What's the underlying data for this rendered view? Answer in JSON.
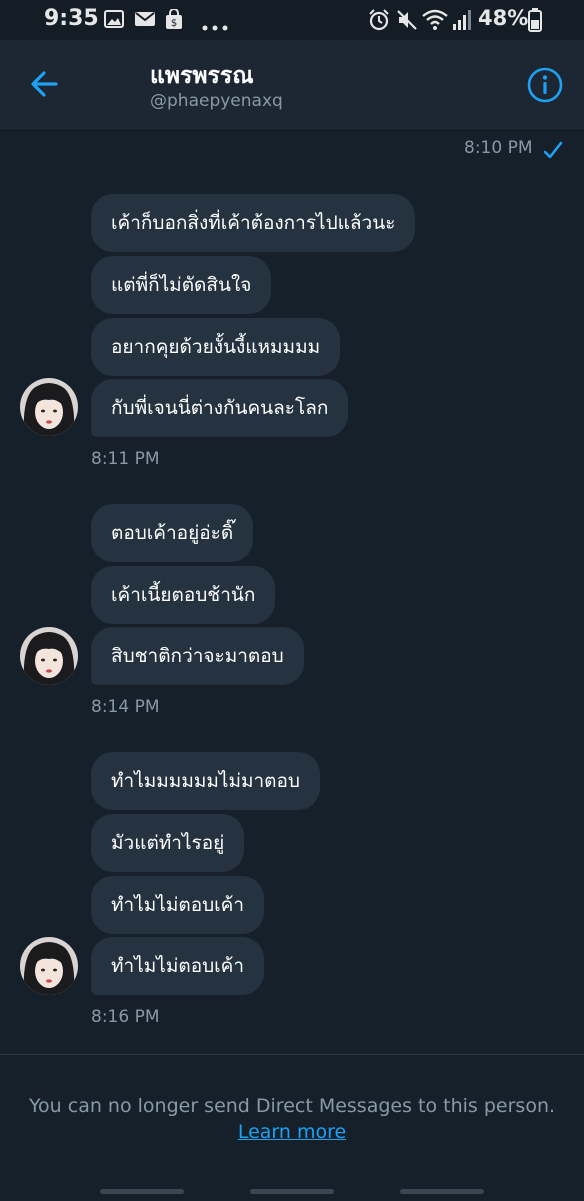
{
  "status_bar": {
    "time": "9:35",
    "battery": "48%",
    "left_icons": [
      "image-icon",
      "mail-icon",
      "shop-icon",
      "more-dots-icon"
    ],
    "right_icons": [
      "alarm-icon",
      "mute-icon",
      "wifi-icon",
      "signal-icon",
      "battery-icon"
    ]
  },
  "header": {
    "name": "แพรพรรณ",
    "handle": "@phaepyenaxq",
    "back_icon": "arrow-left-icon",
    "info_icon": "info-icon",
    "accent_color": "#1da1f2"
  },
  "sent": {
    "time": "8:10 PM",
    "status_icon": "check-icon"
  },
  "groups": [
    {
      "messages": [
        "เค้าก็บอกสิ่งที่เค้าต้องการไปแล้วนะ",
        "แต่พี่ก็ไม่ตัดสินใจ",
        "อยากคุยด้วยงั้นงี้แหมมมม",
        "กับพี่เจนนี่ต่างกันคนละโลก"
      ],
      "time": "8:11 PM"
    },
    {
      "messages": [
        "ตอบเค้าอยู่อ่ะดิ๊",
        "เค้าเนี้ยตอบช้านัก",
        "สิบชาติกว่าจะมาตอบ"
      ],
      "time": "8:14 PM"
    },
    {
      "messages": [
        "ทำไมมมมมมไม่มาตอบ",
        "มัวแต่ทำไรอยู่",
        "ทำไมไม่ตอบเค้า",
        "ทำไมไม่ตอบเค้า"
      ],
      "time": "8:16 PM"
    }
  ],
  "footer": {
    "notice": "You can no longer send Direct Messages to this person.",
    "link": "Learn more"
  },
  "colors": {
    "background": "#15202b",
    "bubble": "#253341",
    "muted_text": "#8899a6",
    "link": "#1da1f2"
  }
}
